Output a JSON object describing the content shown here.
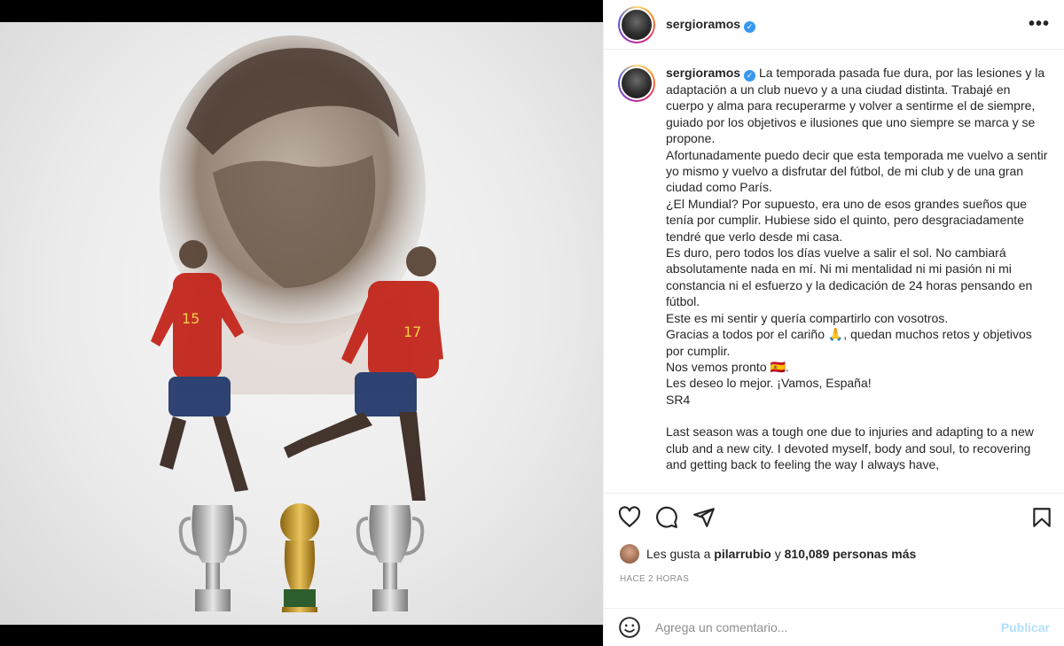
{
  "post": {
    "username": "sergioramos",
    "verified_mark": "✓",
    "more_icon": "•••"
  },
  "caption": {
    "username": "sergioramos",
    "paragraphs": [
      "La temporada pasada fue dura, por las lesiones y la adaptación a un club nuevo y a una ciudad distinta. Trabajé en cuerpo y alma para recuperarme y volver a sentirme el de siempre, guiado por los objetivos e ilusiones que uno siempre se marca y se propone.",
      "Afortunadamente puedo decir que esta temporada me vuelvo a sentir yo mismo y vuelvo a disfrutar del fútbol, de mi club y de una gran ciudad como París.",
      "¿El Mundial? Por supuesto, era uno de esos grandes sueños que tenía por cumplir. Hubiese sido el quinto, pero desgraciadamente tendré que verlo desde mi casa.",
      "Es duro, pero todos los días vuelve a salir el sol. No cambiará absolutamente nada en mí. Ni mi mentalidad ni mi pasión ni mi constancia ni el esfuerzo y la dedicación de 24 horas pensando en fútbol.",
      "Este es mi sentir y quería compartirlo con vosotros.",
      "Gracias a todos por el cariño 🙏, quedan muchos retos y objetivos por cumplir.",
      "Nos vemos pronto 🇪🇸.",
      "Les deseo lo mejor. ¡Vamos, España!",
      "SR4",
      "",
      "Last season was a tough one due to injuries and adapting to a new club and a new city. I devoted myself, body and soul, to recovering and getting back to feeling the way I always have,"
    ]
  },
  "likes": {
    "prefix": "Les gusta a",
    "user": "pilarrubio",
    "joiner": "y",
    "count": "810,089 personas más"
  },
  "time": "HACE 2 HORAS",
  "comment": {
    "placeholder": "Agrega un comentario...",
    "publish": "Publicar"
  },
  "poster": {
    "jersey_left_number": "15",
    "jersey_right_number": "17"
  }
}
